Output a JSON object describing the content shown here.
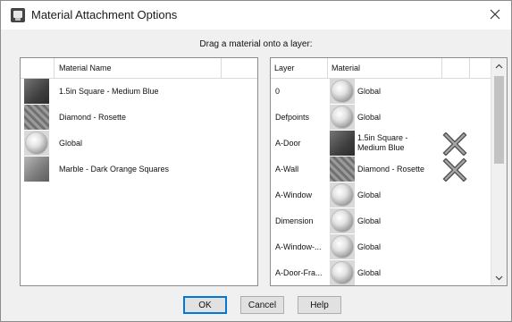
{
  "window": {
    "title": "Material Attachment Options"
  },
  "instructions": "Drag a material onto a layer:",
  "left_list": {
    "header": "Material Name",
    "items": [
      {
        "name": "1.5in Square - Medium Blue",
        "texture": "blue-square-swatch"
      },
      {
        "name": "Diamond - Rosette",
        "texture": "rosette-swatch"
      },
      {
        "name": "Global",
        "texture": "sphere-swatch"
      },
      {
        "name": "Marble - Dark Orange Squares",
        "texture": "marble-swatch"
      }
    ]
  },
  "right_list": {
    "headers": {
      "layer": "Layer",
      "material": "Material"
    },
    "rows": [
      {
        "layer": "0",
        "material": "Global",
        "texture": "sphere-swatch",
        "removable": false
      },
      {
        "layer": "Defpoints",
        "material": "Global",
        "texture": "sphere-swatch",
        "removable": false
      },
      {
        "layer": "A-Door",
        "material": "1.5in Square - Medium Blue",
        "texture": "blue-square-swatch",
        "removable": true
      },
      {
        "layer": "A-Wall",
        "material": "Diamond - Rosette",
        "texture": "rosette-swatch",
        "removable": true
      },
      {
        "layer": "A-Window",
        "material": "Global",
        "texture": "sphere-swatch",
        "removable": false
      },
      {
        "layer": "Dimension",
        "material": "Global",
        "texture": "sphere-swatch",
        "removable": false
      },
      {
        "layer": "A-Window-...",
        "material": "Global",
        "texture": "sphere-swatch",
        "removable": false
      },
      {
        "layer": "A-Door-Fra...",
        "material": "Global",
        "texture": "sphere-swatch",
        "removable": false
      }
    ]
  },
  "buttons": {
    "ok": "OK",
    "cancel": "Cancel",
    "help": "Help"
  }
}
